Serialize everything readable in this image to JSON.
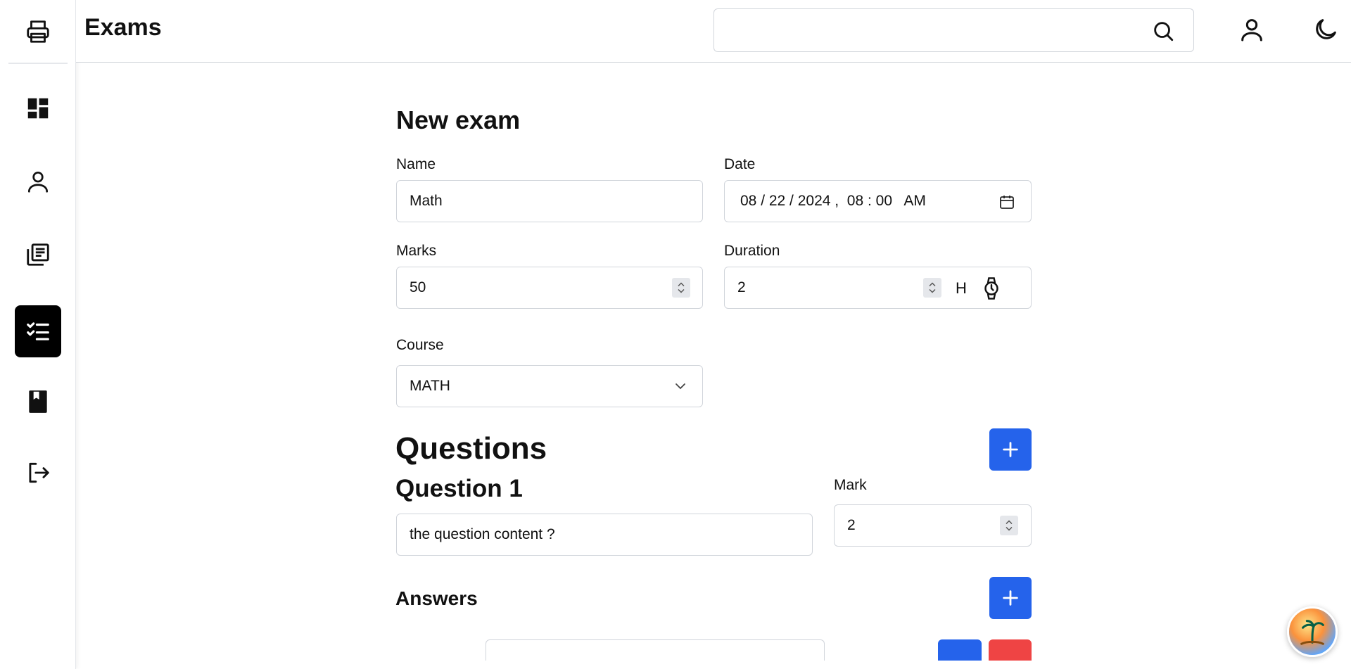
{
  "header": {
    "title": "Exams",
    "search": {
      "value": "",
      "placeholder": ""
    }
  },
  "sidebar": {
    "items": [
      {
        "name": "dashboard"
      },
      {
        "name": "users"
      },
      {
        "name": "courses"
      },
      {
        "name": "exams",
        "active": true
      },
      {
        "name": "library"
      },
      {
        "name": "logout"
      }
    ]
  },
  "form": {
    "title": "New exam",
    "name_label": "Name",
    "name_value": "Math",
    "date_label": "Date",
    "date_value": "08 / 22 / 2024 ,  08 : 00   AM",
    "marks_label": "Marks",
    "marks_value": "50",
    "duration_label": "Duration",
    "duration_value": "2",
    "duration_unit": "H",
    "course_label": "Course",
    "course_value": "MATH"
  },
  "questions": {
    "title": "Questions",
    "items": [
      {
        "title": "Question 1",
        "mark_label": "Mark",
        "mark_value": "2",
        "content": "the question content ?"
      }
    ],
    "answers_title": "Answers"
  },
  "colors": {
    "primary": "#2563eb",
    "danger": "#ef4444",
    "active_nav": "#000000"
  }
}
